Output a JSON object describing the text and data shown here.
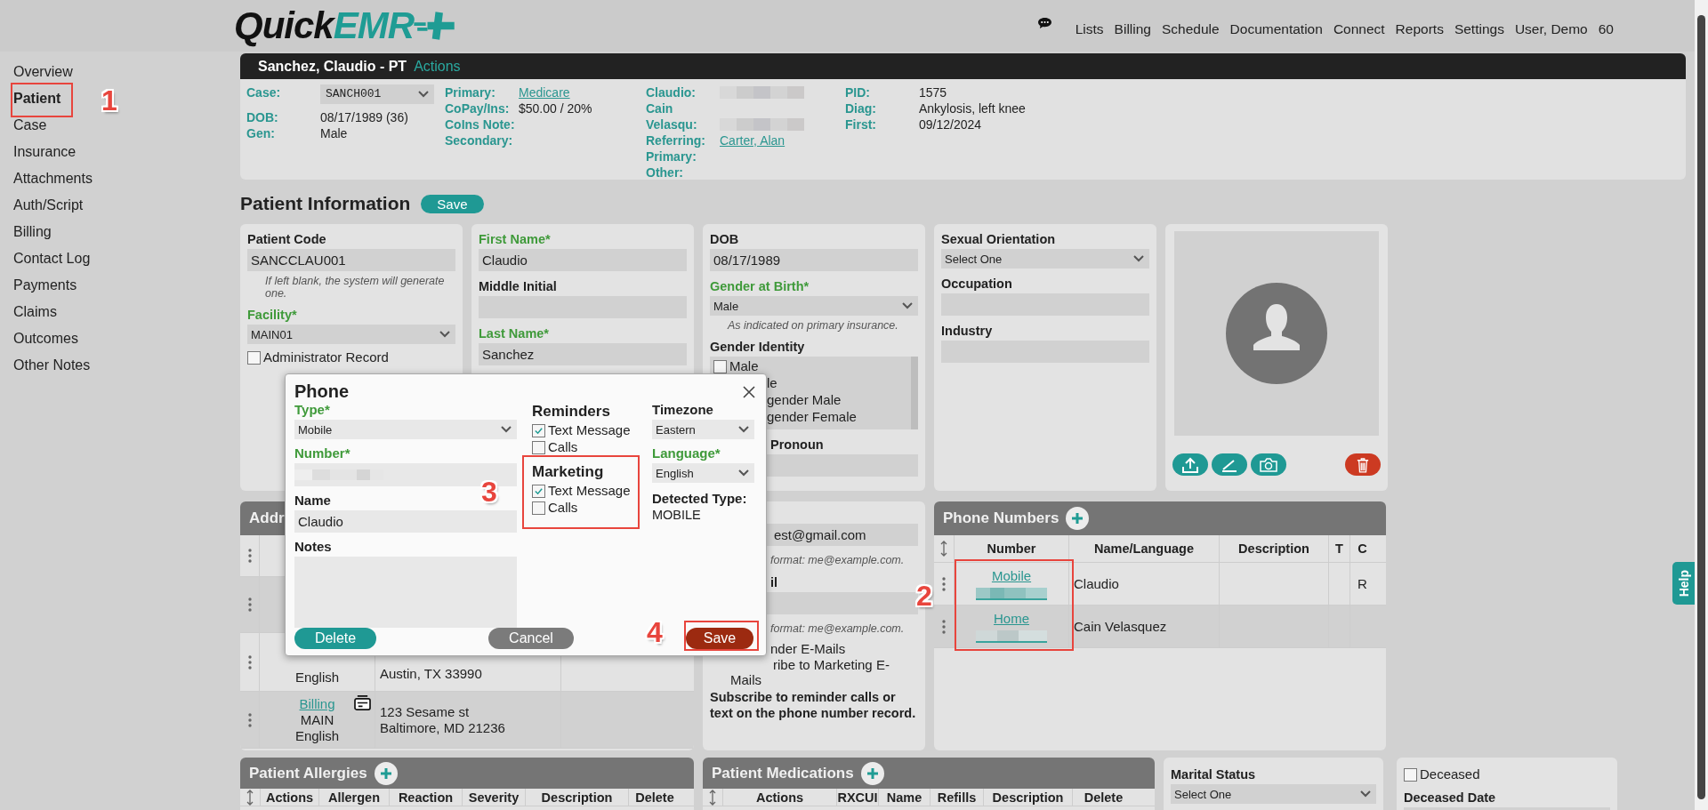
{
  "header": {
    "logo": {
      "word_1": "Quick",
      "word_2": "EMR"
    },
    "nav": [
      "Lists",
      "Billing",
      "Schedule",
      "Documentation",
      "Connect",
      "Reports",
      "Settings",
      "User, Demo",
      "60"
    ]
  },
  "sidebar": {
    "items": [
      {
        "label": "Overview",
        "selected": false
      },
      {
        "label": "Patient",
        "selected": true
      },
      {
        "label": "Case",
        "selected": false
      },
      {
        "label": "Insurance",
        "selected": false
      },
      {
        "label": "Attachments",
        "selected": false
      },
      {
        "label": "Auth/Script",
        "selected": false
      },
      {
        "label": "Billing",
        "selected": false
      },
      {
        "label": "Contact Log",
        "selected": false
      },
      {
        "label": "Payments",
        "selected": false
      },
      {
        "label": "Claims",
        "selected": false
      },
      {
        "label": "Outcomes",
        "selected": false
      },
      {
        "label": "Other Notes",
        "selected": false
      }
    ]
  },
  "patient_bar": {
    "title": "Sanchez, Claudio - PT",
    "actions": "Actions",
    "groups": [
      [
        {
          "label": "Case:",
          "kind": "select",
          "value": "SANCH001"
        },
        {
          "label": "DOB:",
          "kind": "text",
          "value": "08/17/1989 (36)"
        },
        {
          "label": "Gen:",
          "kind": "text",
          "value": "Male"
        }
      ],
      [
        {
          "label": "Primary:",
          "kind": "link",
          "value": "Medicare"
        },
        {
          "label": "CoPay/Ins:",
          "kind": "text",
          "value": "$50.00 / 20%"
        },
        {
          "label": "CoIns Note:"
        },
        {
          "label": "Secondary:"
        }
      ],
      [
        {
          "label": "Claudio:",
          "kind": "redacted"
        },
        {
          "label": "Cain"
        },
        {
          "label": "Velasqu:",
          "kind": "redacted"
        },
        {
          "label": "Referring:",
          "kind": "link",
          "value": "Carter, Alan"
        },
        {
          "label": "Primary:"
        },
        {
          "label": "Other:"
        }
      ],
      [
        {
          "label": "PID:",
          "kind": "text",
          "value": "1575"
        },
        {
          "label": "Diag:",
          "kind": "text",
          "value": "Ankylosis, left knee"
        },
        {
          "label": "First:",
          "kind": "text",
          "value": "09/12/2024"
        }
      ]
    ]
  },
  "heading": {
    "title": "Patient Information",
    "save": "Save"
  },
  "cards": [
    [
      {
        "kind": "label",
        "text": "Patient Code",
        "required": false
      },
      {
        "kind": "input",
        "value": "SANCCLAU001"
      },
      {
        "kind": "hint",
        "text": "If left blank, the system will generate one."
      },
      {
        "kind": "label",
        "text": "Facility*",
        "required": true
      },
      {
        "kind": "select",
        "value": "MAIN01"
      },
      {
        "kind": "checkbox",
        "label": "Administrator Record",
        "checked": false
      }
    ],
    [
      {
        "kind": "label",
        "text": "First Name*",
        "required": true
      },
      {
        "kind": "input",
        "value": "Claudio"
      },
      {
        "kind": "label",
        "text": "Middle Initial",
        "required": false
      },
      {
        "kind": "input"
      },
      {
        "kind": "label",
        "text": "Last Name*",
        "required": true
      },
      {
        "kind": "input",
        "value": "Sanchez"
      }
    ],
    [
      {
        "kind": "label",
        "text": "DOB",
        "required": false
      },
      {
        "kind": "input",
        "value": "08/17/1989"
      },
      {
        "kind": "label",
        "text": "Gender at Birth*",
        "required": true
      },
      {
        "kind": "select",
        "value": "Male"
      },
      {
        "kind": "hint",
        "text": "As indicated on primary insurance."
      },
      {
        "kind": "label",
        "text": "Gender Identity",
        "required": false
      },
      {
        "kind": "listbox",
        "options": [
          {
            "kind": "checkbox",
            "label": "Male",
            "checked": false
          },
          {
            "kind": "cut",
            "label": "le"
          },
          {
            "kind": "cut",
            "label": "gender Male"
          },
          {
            "kind": "cut",
            "label": "gender Female"
          }
        ]
      },
      {
        "kind": "cut-label",
        "text": "Pronoun"
      },
      {
        "kind": "input"
      }
    ],
    [
      {
        "kind": "label",
        "text": "Sexual Orientation",
        "required": false
      },
      {
        "kind": "select",
        "value": "Select One"
      },
      {
        "kind": "label",
        "text": "Occupation",
        "required": false
      },
      {
        "kind": "input"
      },
      {
        "kind": "label",
        "text": "Industry",
        "required": false
      },
      {
        "kind": "input"
      }
    ]
  ],
  "photo": {
    "buttons": [
      {
        "kind": "upload"
      },
      {
        "kind": "sign"
      },
      {
        "kind": "camera"
      },
      {
        "kind": "delete"
      }
    ]
  },
  "addresses": {
    "title": "Addr",
    "rows": [
      {
        "lines": [
          "English"
        ],
        "address": [
          "Austin, TX 33990"
        ],
        "card_icon": false
      },
      {
        "name": {
          "kind": "link",
          "text": "Billing"
        },
        "lines": [
          "MAIN",
          "English"
        ],
        "address": [
          "123 Sesame st",
          "Baltimore, MD 21236"
        ],
        "card_icon": true
      }
    ]
  },
  "email_card": [
    {
      "kind": "cut-input",
      "value": "est@gmail.com"
    },
    {
      "kind": "cut-hint",
      "text": "format: me@example.com."
    },
    {
      "kind": "cut-label",
      "text": "il"
    },
    {
      "kind": "input"
    },
    {
      "kind": "cut-hint",
      "text": "format: me@example.com."
    },
    {
      "kind": "cut-text",
      "text": "nder E-Mails"
    },
    {
      "kind": "cut-wrap",
      "text": "ribe to Marketing E-Mails"
    },
    {
      "kind": "note",
      "text": "Subscribe to reminder calls or text on the phone number record."
    }
  ],
  "phone_numbers": {
    "title": "Phone Numbers",
    "columns": [
      "Number",
      "Name/Language",
      "Description",
      "T",
      "C"
    ],
    "rows": [
      {
        "type": "Mobile",
        "name": "Claudio",
        "c": "R",
        "highlighted": false
      },
      {
        "type": "Home",
        "name": "Cain Velasquez",
        "highlighted": true
      }
    ]
  },
  "allergies": {
    "title": "Patient Allergies",
    "columns": [
      "Actions",
      "Allergen",
      "Reaction",
      "Severity",
      "Description",
      "Delete"
    ]
  },
  "medications": {
    "title": "Patient Medications",
    "columns": [
      "Actions",
      "RXCUI",
      "Name",
      "Refills",
      "Description",
      "Delete"
    ]
  },
  "marital": [
    {
      "kind": "label",
      "text": "Marital Status",
      "required": false
    },
    {
      "kind": "select",
      "value": "Select One"
    }
  ],
  "deceased": [
    {
      "kind": "checkbox",
      "label": "Deceased",
      "checked": false
    },
    {
      "kind": "label",
      "text": "Deceased Date",
      "required": false
    },
    {
      "kind": "input"
    }
  ],
  "phone_dialog": {
    "title": "Phone",
    "type": {
      "label": "Type*",
      "required": true,
      "value": "Mobile"
    },
    "number": {
      "label": "Number*",
      "required": true
    },
    "name": {
      "label": "Name",
      "required": false,
      "value": "Claudio"
    },
    "notes": {
      "label": "Notes",
      "required": false
    },
    "groups": [
      {
        "title": "Reminders",
        "options": [
          {
            "label": "Text Message",
            "checked": true
          },
          {
            "label": "Calls",
            "checked": false
          }
        ]
      },
      {
        "title": "Marketing",
        "options": [
          {
            "label": "Text Message",
            "checked": true
          },
          {
            "label": "Calls",
            "checked": false
          }
        ]
      }
    ],
    "timezone": {
      "label": "Timezone",
      "required": false,
      "value": "Eastern"
    },
    "language": {
      "label": "Language*",
      "required": true,
      "value": "English"
    },
    "detected": {
      "label": "Detected Type:",
      "value": "MOBILE"
    },
    "buttons": [
      {
        "kind": "delete",
        "label": "Delete"
      },
      {
        "kind": "cancel",
        "label": "Cancel"
      },
      {
        "kind": "save",
        "label": "Save"
      }
    ]
  },
  "annotations": [
    {
      "label": "1"
    },
    {
      "label": "2"
    },
    {
      "label": "3"
    },
    {
      "label": "4"
    }
  ],
  "help_tab": {
    "label": "Help"
  }
}
